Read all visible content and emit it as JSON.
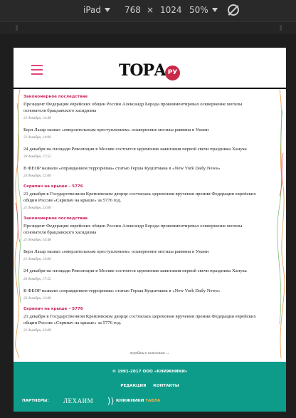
{
  "devtools": {
    "device": "iPad",
    "width": "768",
    "times": "×",
    "height": "1024",
    "zoom": "50%"
  },
  "header": {
    "logo_text": "ТОРА",
    "logo_suffix": "РУ"
  },
  "feed": [
    {
      "category": "Закономерное последствие",
      "headline": "Президент Федерации еврейских общин России Александр Борода прокомментировал осквернение могилы основателя брацлавского хасидизма",
      "date": "21 декабря, 14:48"
    },
    {
      "category": "",
      "headline": "Берл Лазар назвал «омерзительным преступлением» осквернение могилы раввина в Умани",
      "date": "21 декабря, 14:00"
    },
    {
      "category": "",
      "headline": "24 декабря на площади Революции в Москве состоится церемония зажигания первой свечи праздника Ханука",
      "date": "20 декабря, 17:52"
    },
    {
      "category": "",
      "headline": "В ФЕОР назвали «оправданием терроризма» статью Герша Куцштмана в «New York Daily News»",
      "date": "23 декабря, 12:06"
    },
    {
      "category": "Скрипач на крыше – 5776",
      "headline": "21 декабря в Государственном Кремлевском дворце состоялась церемония вручения премии Федерации еврейских общин России «Скрипач на крыше» за 5776 год.",
      "date": "21 декабря, 23:08"
    },
    {
      "category": "Закономерное последствие",
      "headline": "Президент Федерации еврейских общин России Александр Борода прокомментировал осквернение могилы основателя брацлавского хасидизма",
      "date": "21 декабря, 14:48"
    },
    {
      "category": "",
      "headline": "Берл Лазар назвал «омерзительным преступлением» осквернение могилы раввина в Умани",
      "date": "21 декабря, 14:00"
    },
    {
      "category": "",
      "headline": "24 декабря на площади Революции в Москве состоится церемония зажигания первой свечи праздника Ханука",
      "date": "20 декабря, 17:52"
    },
    {
      "category": "",
      "headline": "В ФЕОР назвали «оправданием терроризма» статью Герша Куцштмана в «New York Daily News»",
      "date": "23 декабря, 12:06"
    },
    {
      "category": "Скрипач на крыше – 5776",
      "headline": "21 декабря в Государственном Кремлевском дворце состоялась церемония вручения премии Федерации еврейских общин России «Скрипач на крыше» за 5776 год.",
      "date": "21 декабря, 23:08"
    }
  ],
  "more_link": "перейти к новостям →",
  "footer": {
    "copyright": "© 1991-2017 ООО «КНИЖНИКИ»",
    "links": [
      "РЕДАКЦИЯ",
      "КОНТАКТЫ"
    ],
    "partners_label": "ПАРТНЕРЫ:",
    "partner_lechaim": "ЛЕХАИМ",
    "partner_knizhniki_mark": "⟩⟩",
    "partner_knizhniki": "КНИЖНИКИ",
    "partner_tavla": "ТАВЛА"
  },
  "colors": {
    "accent_pink": "#c8215f",
    "footer_teal": "#0e9c8a",
    "logo_red": "#c92a4a"
  }
}
